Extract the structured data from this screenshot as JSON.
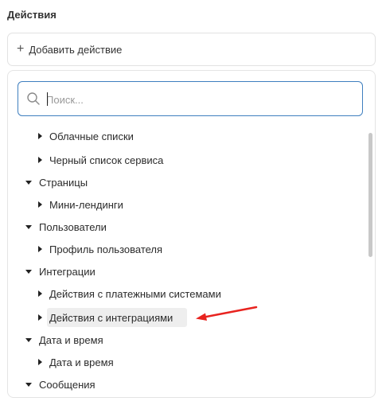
{
  "section": {
    "title": "Действия"
  },
  "add_action": {
    "plus": "+",
    "label": "Добавить действие"
  },
  "search": {
    "placeholder": "Поиск..."
  },
  "tree": [
    {
      "label": "Облачные списки",
      "level": "child",
      "expanded": false
    },
    {
      "label": "Черный список сервиса",
      "level": "child",
      "expanded": false
    },
    {
      "label": "Страницы",
      "level": "parent",
      "expanded": true
    },
    {
      "label": "Мини-лендинги",
      "level": "child",
      "expanded": false
    },
    {
      "label": "Пользователи",
      "level": "parent",
      "expanded": true
    },
    {
      "label": "Профиль пользователя",
      "level": "child",
      "expanded": false
    },
    {
      "label": "Интеграции",
      "level": "parent",
      "expanded": true
    },
    {
      "label": "Действия с платежными системами",
      "level": "child",
      "expanded": false
    },
    {
      "label": "Действия с интеграциями",
      "level": "child",
      "expanded": false,
      "highlighted": true
    },
    {
      "label": "Дата и время",
      "level": "parent",
      "expanded": true
    },
    {
      "label": "Дата и время",
      "level": "child",
      "expanded": false
    },
    {
      "label": "Сообщения",
      "level": "parent",
      "expanded": true
    }
  ],
  "colors": {
    "search_border": "#3f7fbf",
    "highlight_bg": "#eeeeee",
    "annotation_arrow": "#e8231f"
  },
  "icons": {
    "search": "search-icon",
    "expand": "triangle-right-icon",
    "collapse": "triangle-down-icon",
    "annotation": "red-arrow-icon"
  }
}
